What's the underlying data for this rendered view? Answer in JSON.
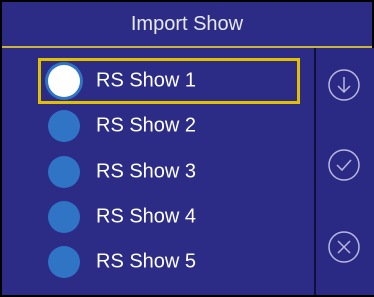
{
  "title": "Import Show",
  "shows": [
    {
      "label": "RS Show 1",
      "selected": true
    },
    {
      "label": "RS Show 2",
      "selected": false
    },
    {
      "label": "RS Show 3",
      "selected": false
    },
    {
      "label": "RS Show 4",
      "selected": false
    },
    {
      "label": "RS Show 5",
      "selected": false
    }
  ],
  "sidebar": {
    "buttons": [
      {
        "name": "download",
        "icon": "download-icon"
      },
      {
        "name": "confirm",
        "icon": "check-icon"
      },
      {
        "name": "cancel",
        "icon": "close-icon"
      }
    ]
  },
  "colors": {
    "background": "#2c2c86",
    "highlight": "#e0c000",
    "radio": "#2f74c5",
    "title_divider": "#c8b43c"
  }
}
